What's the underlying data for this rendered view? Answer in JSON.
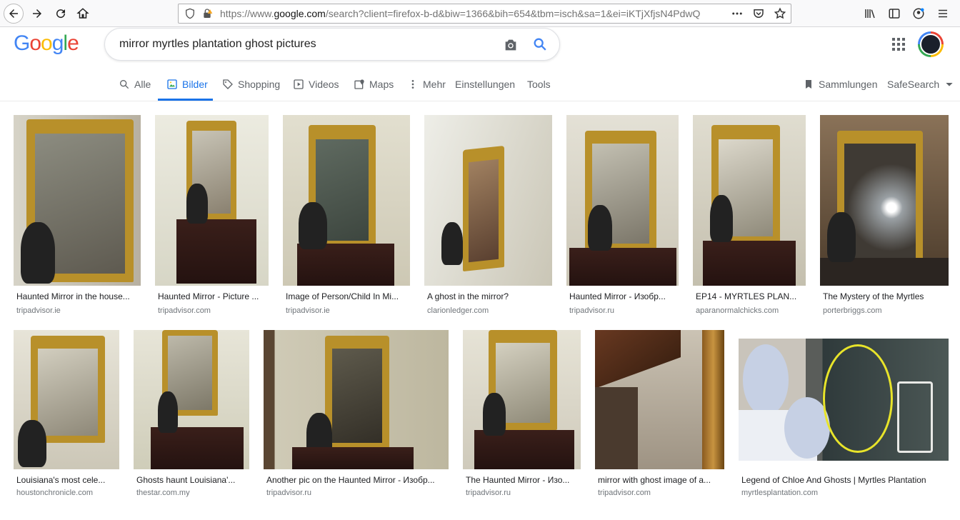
{
  "browser": {
    "url_prefix": "https://www.",
    "url_host": "google.com",
    "url_rest": "/search?client=firefox-b-d&biw=1366&bih=654&tbm=isch&sa=1&ei=iKTjXfjsN4PdwQ"
  },
  "google": {
    "logo_text": "Google",
    "query": "mirror myrtles plantation ghost pictures"
  },
  "tabs": [
    {
      "label": "Alle",
      "icon": "search-icon"
    },
    {
      "label": "Bilder",
      "icon": "image-icon",
      "active": true
    },
    {
      "label": "Shopping",
      "icon": "tag-icon"
    },
    {
      "label": "Videos",
      "icon": "play-icon"
    },
    {
      "label": "Maps",
      "icon": "map-icon"
    },
    {
      "label": "Mehr",
      "icon": "more-vert-icon"
    },
    {
      "label": "Einstellungen"
    },
    {
      "label": "Tools"
    }
  ],
  "right_tabs": {
    "collections": "Sammlungen",
    "safesearch": "SafeSearch"
  },
  "results": [
    {
      "title": "Haunted Mirror in the house...",
      "source": "tripadvisor.ie"
    },
    {
      "title": "Haunted Mirror - Picture ...",
      "source": "tripadvisor.com"
    },
    {
      "title": "Image of Person/Child In Mi...",
      "source": "tripadvisor.ie"
    },
    {
      "title": "A ghost in the mirror?",
      "source": "clarionledger.com"
    },
    {
      "title": "Haunted Mirror - Изобр...",
      "source": "tripadvisor.ru"
    },
    {
      "title": "EP14 - MYRTLES PLAN...",
      "source": "aparanormalchicks.com"
    },
    {
      "title": "The Mystery of the Myrtles",
      "source": "porterbriggs.com"
    },
    {
      "title": "Louisiana's most cele...",
      "source": "houstonchronicle.com"
    },
    {
      "title": "Ghosts haunt Louisiana'...",
      "source": "thestar.com.my"
    },
    {
      "title": "Another pic on the Haunted Mirror - Изобр...",
      "source": "tripadvisor.ru"
    },
    {
      "title": "The Haunted Mirror - Изо...",
      "source": "tripadvisor.ru"
    },
    {
      "title": "mirror with ghost image of a...",
      "source": "tripadvisor.com"
    },
    {
      "title": "Legend of Chloe And Ghosts | Myrtles Plantation",
      "source": "myrtlesplantation.com"
    }
  ],
  "colors": {
    "accent": "#1a73e8",
    "gold": "#b8902a"
  }
}
